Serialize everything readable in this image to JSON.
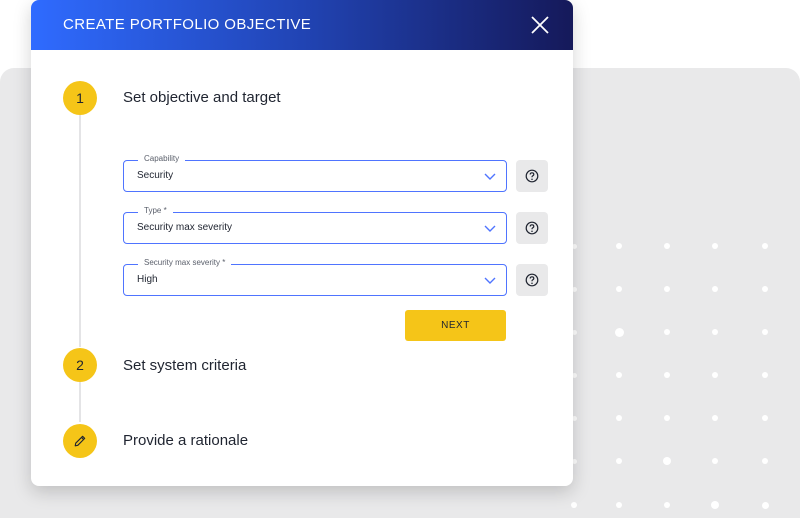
{
  "modal": {
    "title": "CREATE PORTFOLIO OBJECTIVE"
  },
  "steps": [
    {
      "number": "1",
      "label": "Set objective and target"
    },
    {
      "number": "2",
      "label": "Set system criteria"
    },
    {
      "icon": "pencil-icon",
      "label": "Provide a rationale"
    }
  ],
  "form": {
    "capability": {
      "label": "Capability",
      "value": "Security"
    },
    "type": {
      "label": "Type *",
      "value": "Security max severity"
    },
    "severity": {
      "label": "Security max severity *",
      "value": "High"
    },
    "next_label": "NEXT"
  },
  "colors": {
    "accent_yellow": "#f5c518",
    "field_border": "#4f74ff",
    "header_gradient_start": "#2f6bff",
    "header_gradient_end": "#15195a",
    "background_panel": "#e9e9ea"
  }
}
